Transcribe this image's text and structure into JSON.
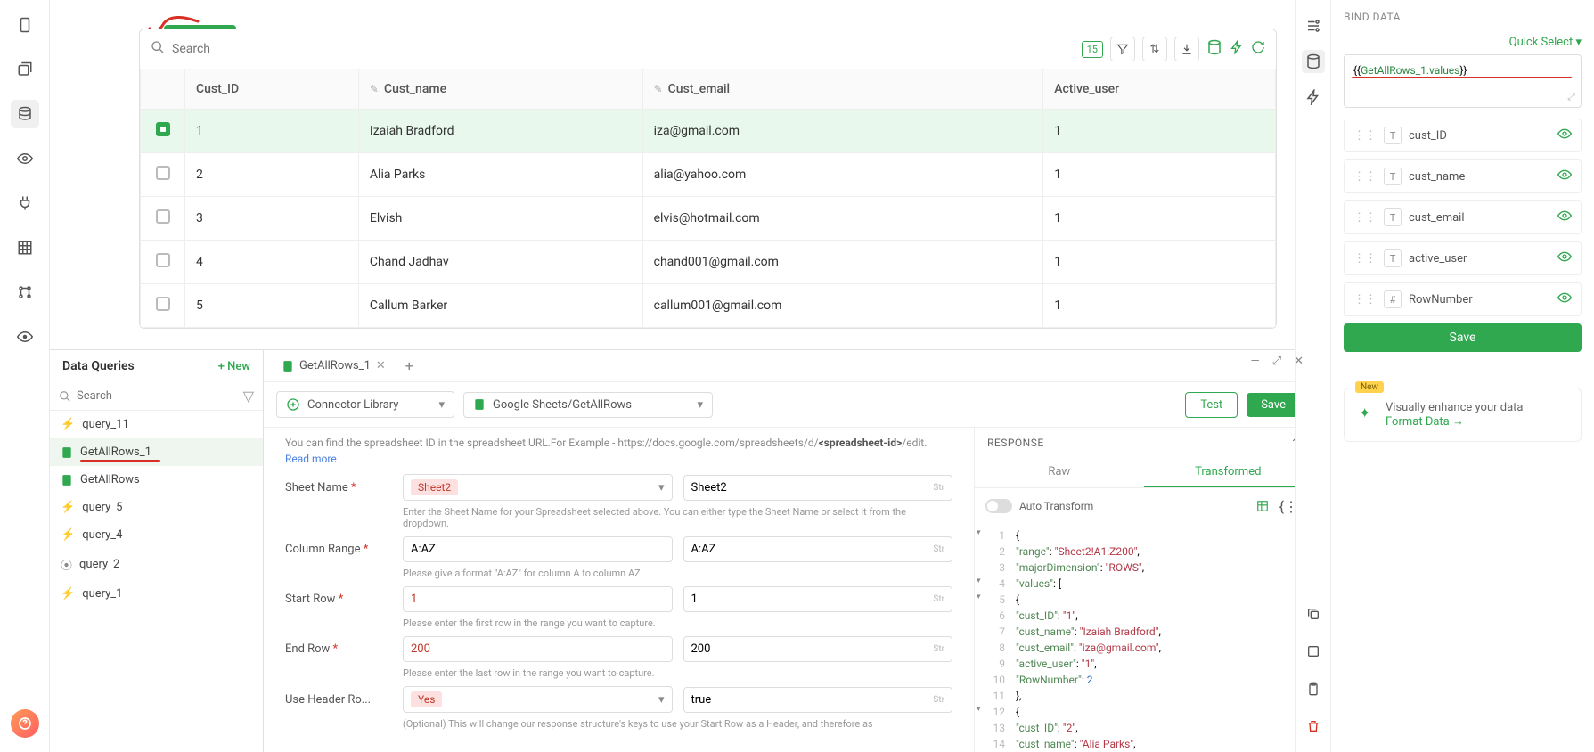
{
  "tablegrid_badge": "tablegrid",
  "search_placeholder": "Search",
  "count_badge": "15",
  "columns": {
    "c0": "Cust_ID",
    "c1": "Cust_name",
    "c2": "Cust_email",
    "c3": "Active_user"
  },
  "rows": [
    {
      "id": "1",
      "name": "Izaiah Bradford",
      "email": "iza@gmail.com",
      "active": "1",
      "sel": true
    },
    {
      "id": "2",
      "name": "Alia Parks",
      "email": "alia@yahoo.com",
      "active": "1"
    },
    {
      "id": "3",
      "name": "Elvish",
      "email": "elvis@hotmail.com",
      "active": "1"
    },
    {
      "id": "4",
      "name": "Chand Jadhav",
      "email": "chand001@gmail.com",
      "active": "1"
    },
    {
      "id": "5",
      "name": "Callum Barker",
      "email": "callum001@gmail.com",
      "active": "1"
    }
  ],
  "queries_title": "Data Queries",
  "new_label": "+ New",
  "queries_search_placeholder": "Search",
  "queries": [
    {
      "name": "query_11",
      "type": "bolt"
    },
    {
      "name": "GetAllRows_1",
      "type": "sheet",
      "active": true,
      "underline": true
    },
    {
      "name": "GetAllRows",
      "type": "sheet"
    },
    {
      "name": "query_5",
      "type": "bolt"
    },
    {
      "name": "query_4",
      "type": "bolt"
    },
    {
      "name": "query_2",
      "type": "db"
    },
    {
      "name": "query_1",
      "type": "bolt"
    }
  ],
  "qe_tab": "GetAllRows_1",
  "connector_library": "Connector Library",
  "connector_action": "Google Sheets/GetAllRows",
  "test_btn": "Test",
  "save_btn": "Save",
  "form_hint_prefix": "You can find the spreadsheet ID in the spreadsheet URL.For Example - https://docs.google.com/spreadsheets/d/",
  "form_hint_bold": "<spreadsheet-id>",
  "form_hint_suffix": "/edit. ",
  "read_more": "Read more",
  "form": {
    "sheet_name": {
      "label": "Sheet Name",
      "pill": "Sheet2",
      "value": "Sheet2",
      "hint": "Enter the Sheet Name for your Spreadsheet selected above. You can either type the Sheet Name or select it from the dropdown."
    },
    "column_range": {
      "label": "Column Range",
      "value": "A:AZ",
      "value2": "A:AZ",
      "hint": "Please give a format \"A:AZ\" for column A to column AZ."
    },
    "start_row": {
      "label": "Start Row",
      "value": "1",
      "value2": "1",
      "hint": "Please enter the first row in the range you want to capture."
    },
    "end_row": {
      "label": "End Row",
      "value": "200",
      "value2": "200",
      "hint": "Please enter the last row in the range you want to capture."
    },
    "use_header": {
      "label": "Use Header Ro...",
      "pill": "Yes",
      "value": "true",
      "hint": "(Optional) This will change our response structure's keys to use your Start Row as a Header, and therefore as"
    }
  },
  "response_title": "RESPONSE",
  "raw_tab": "Raw",
  "trans_tab": "Transformed",
  "auto_transform": "Auto Transform",
  "code_lines": [
    {
      "n": 1,
      "t": "{",
      "exp": "-"
    },
    {
      "n": 2,
      "t": "   \"range\": \"Sheet2!A1:Z200\","
    },
    {
      "n": 3,
      "t": "   \"majorDimension\": \"ROWS\","
    },
    {
      "n": 4,
      "t": "   \"values\": [",
      "exp": "-"
    },
    {
      "n": 5,
      "t": "      {",
      "exp": "-"
    },
    {
      "n": 6,
      "t": "         \"cust_ID\": \"1\","
    },
    {
      "n": 7,
      "t": "         \"cust_name\": \"Izaiah Bradford\","
    },
    {
      "n": 8,
      "t": "         \"cust_email\": \"iza@gmail.com\","
    },
    {
      "n": 9,
      "t": "         \"active_user\": \"1\","
    },
    {
      "n": 10,
      "t": "         \"RowNumber\": 2"
    },
    {
      "n": 11,
      "t": "      },"
    },
    {
      "n": 12,
      "t": "      {",
      "exp": "-"
    },
    {
      "n": 13,
      "t": "         \"cust_ID\": \"2\","
    },
    {
      "n": 14,
      "t": "         \"cust_name\": \"Alia Parks\","
    }
  ],
  "bind": {
    "title": "BIND DATA",
    "quick": "Quick Select",
    "expr_open": "{{",
    "expr_fn": "GetAllRows_1.values",
    "expr_close": "}}",
    "fields": [
      {
        "name": "cust_ID",
        "type": "T"
      },
      {
        "name": "cust_name",
        "type": "T"
      },
      {
        "name": "cust_email",
        "type": "T"
      },
      {
        "name": "active_user",
        "type": "T"
      },
      {
        "name": "RowNumber",
        "type": "#"
      }
    ],
    "save": "Save",
    "format_new": "New",
    "format_text": "Visually enhance your data",
    "format_link": "Format Data →"
  },
  "str": "Str"
}
